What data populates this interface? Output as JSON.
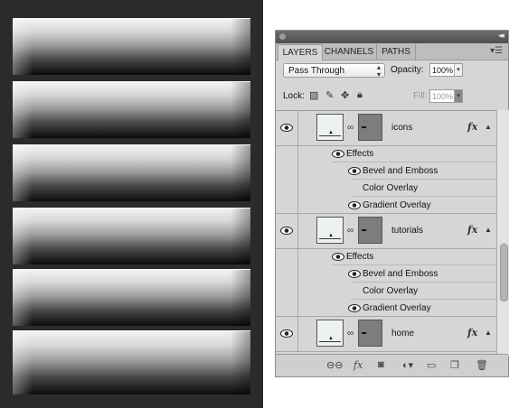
{
  "canvas": {
    "buttons": 6
  },
  "panel": {
    "tabs": [
      "LAYERS",
      "CHANNELS",
      "PATHS"
    ],
    "blend_mode": "Pass Through",
    "opacity_label": "Opacity:",
    "opacity_value": "100%",
    "lock_label": "Lock:",
    "fill_label": "Fill:",
    "fill_value": "100%",
    "layers": [
      {
        "name": "icons",
        "effects_label": "Effects",
        "effects": [
          "Bevel and Emboss",
          "Color Overlay",
          "Gradient Overlay"
        ]
      },
      {
        "name": "tutorials",
        "effects_label": "Effects",
        "effects": [
          "Bevel and Emboss",
          "Color Overlay",
          "Gradient Overlay"
        ]
      },
      {
        "name": "home"
      }
    ],
    "fx_label": "fx"
  },
  "icons": {
    "eye": "eye-icon",
    "link": "link-icon",
    "fx": "fx-icon",
    "mask": "mask-icon",
    "adjustment": "adjustment-icon",
    "folder": "folder-icon",
    "new_layer": "new-layer-icon",
    "trash": "trash-icon"
  }
}
